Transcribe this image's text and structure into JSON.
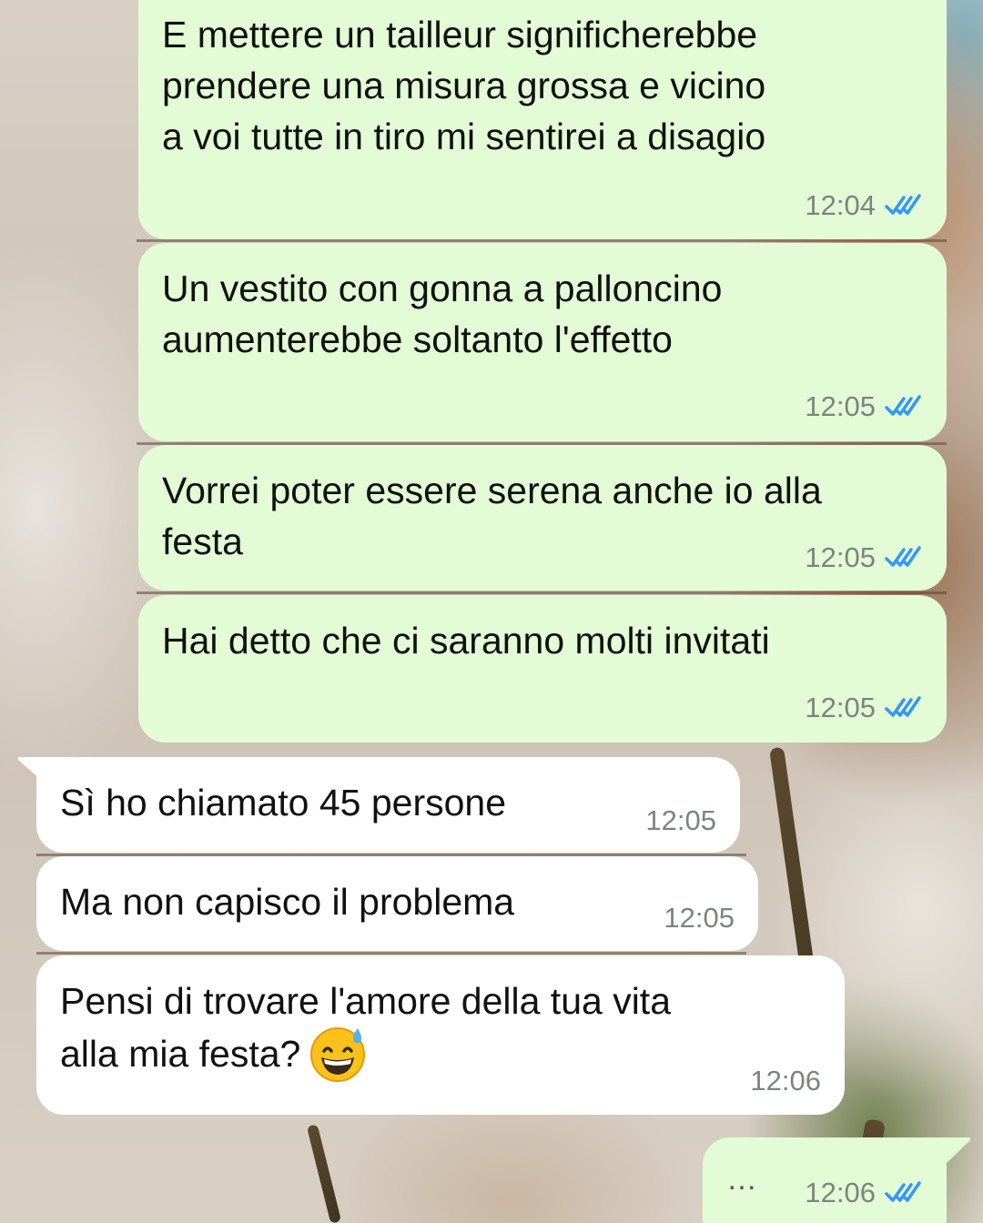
{
  "messages": [
    {
      "direction": "outgoing",
      "lines": [
        "E mettere un tailleur significherebbe",
        "prendere una misura grossa e vicino",
        "a voi tutte in tiro mi sentirei a disagio"
      ],
      "time": "12:04",
      "status": "read",
      "status_icon": "double-check-icon"
    },
    {
      "direction": "outgoing",
      "lines": [
        "Un vestito con gonna a palloncino",
        "aumenterebbe soltanto l'effetto"
      ],
      "time": "12:05",
      "status": "read",
      "status_icon": "double-check-icon"
    },
    {
      "direction": "outgoing",
      "lines": [
        "Vorrei poter essere serena anche io alla",
        "festa"
      ],
      "time": "12:05",
      "status": "read",
      "status_icon": "double-check-icon"
    },
    {
      "direction": "outgoing",
      "lines": [
        "Hai detto che ci saranno molti invitati"
      ],
      "time": "12:05",
      "status": "read",
      "status_icon": "double-check-icon"
    },
    {
      "direction": "incoming",
      "lines": [
        "Sì ho chiamato 45 persone"
      ],
      "time": "12:05"
    },
    {
      "direction": "incoming",
      "lines": [
        "Ma non capisco il problema"
      ],
      "time": "12:05"
    },
    {
      "direction": "incoming",
      "lines": [
        "Pensi di trovare l'amore della tua vita",
        "alla mia festa?"
      ],
      "emoji": "grinning-face-with-sweat-emoji",
      "time": "12:06"
    },
    {
      "direction": "outgoing",
      "lines": [
        "…"
      ],
      "time": "12:06",
      "status": "read",
      "status_icon": "double-check-icon"
    }
  ],
  "colors": {
    "outgoing_bubble": "#e4fcd6",
    "incoming_bubble": "#ffffff",
    "timestamp": "#7b857e",
    "read_ticks": "#3497f9",
    "message_text": "#111111"
  }
}
